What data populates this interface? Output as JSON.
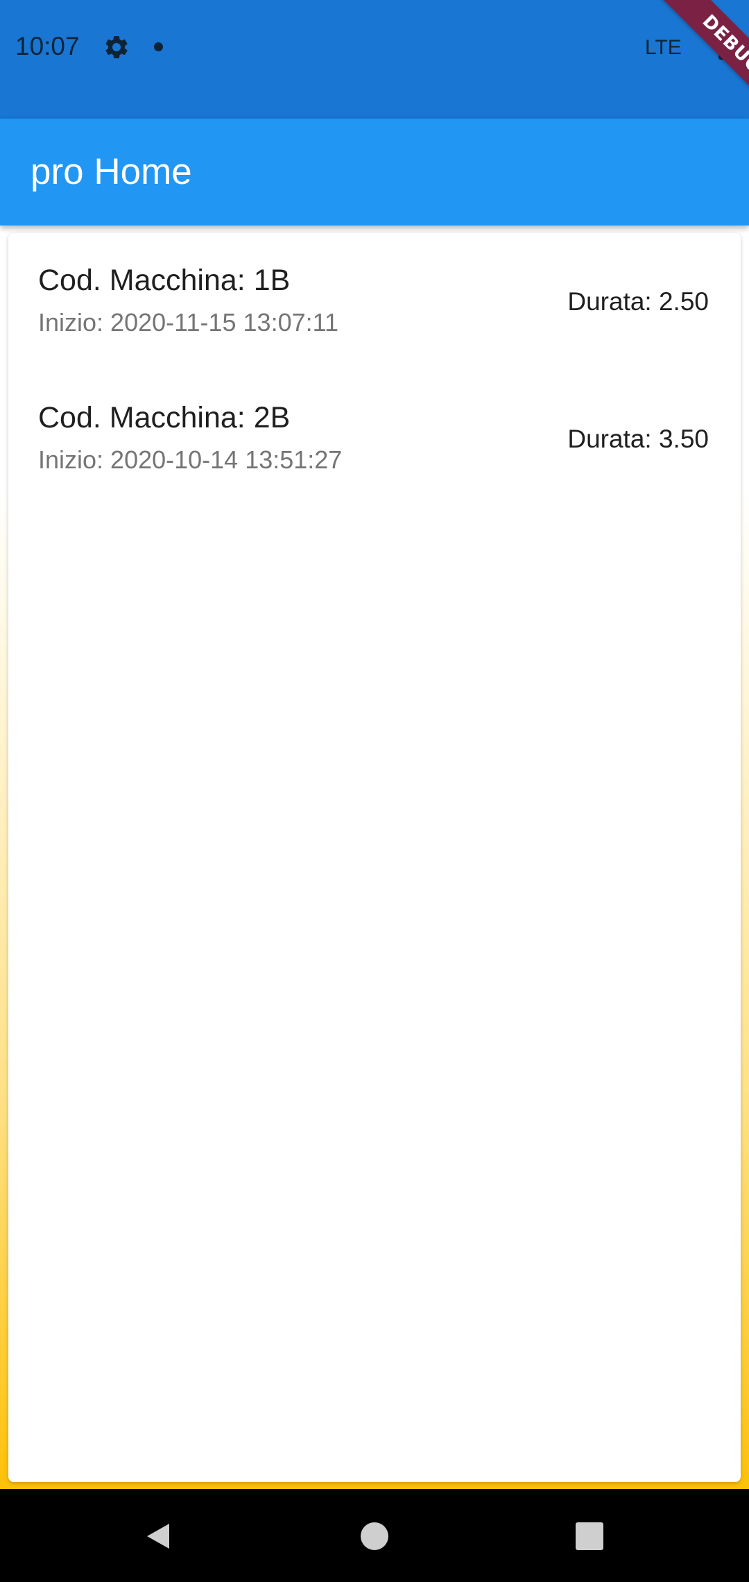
{
  "status_bar": {
    "time": "10:07",
    "network": "LTE",
    "icons": [
      "gear-icon",
      "notification-dot-icon",
      "battery-icon"
    ],
    "color": "#1976d2"
  },
  "debug_banner": "DEBUG",
  "app_bar": {
    "title": "pro Home",
    "color": "#2196f3"
  },
  "list": {
    "items": [
      {
        "title": "Cod. Macchina: 1B",
        "subtitle": "Inizio: 2020-11-15 13:07:11",
        "trailing": "Durata: 2.50"
      },
      {
        "title": "Cod. Macchina: 2B",
        "subtitle": "Inizio: 2020-10-14 13:51:27",
        "trailing": "Durata: 3.50"
      }
    ]
  },
  "nav_bar": {
    "buttons": [
      "back-icon",
      "home-icon",
      "recents-icon"
    ]
  },
  "colors": {
    "background_gradient_end": "#ffc107"
  }
}
